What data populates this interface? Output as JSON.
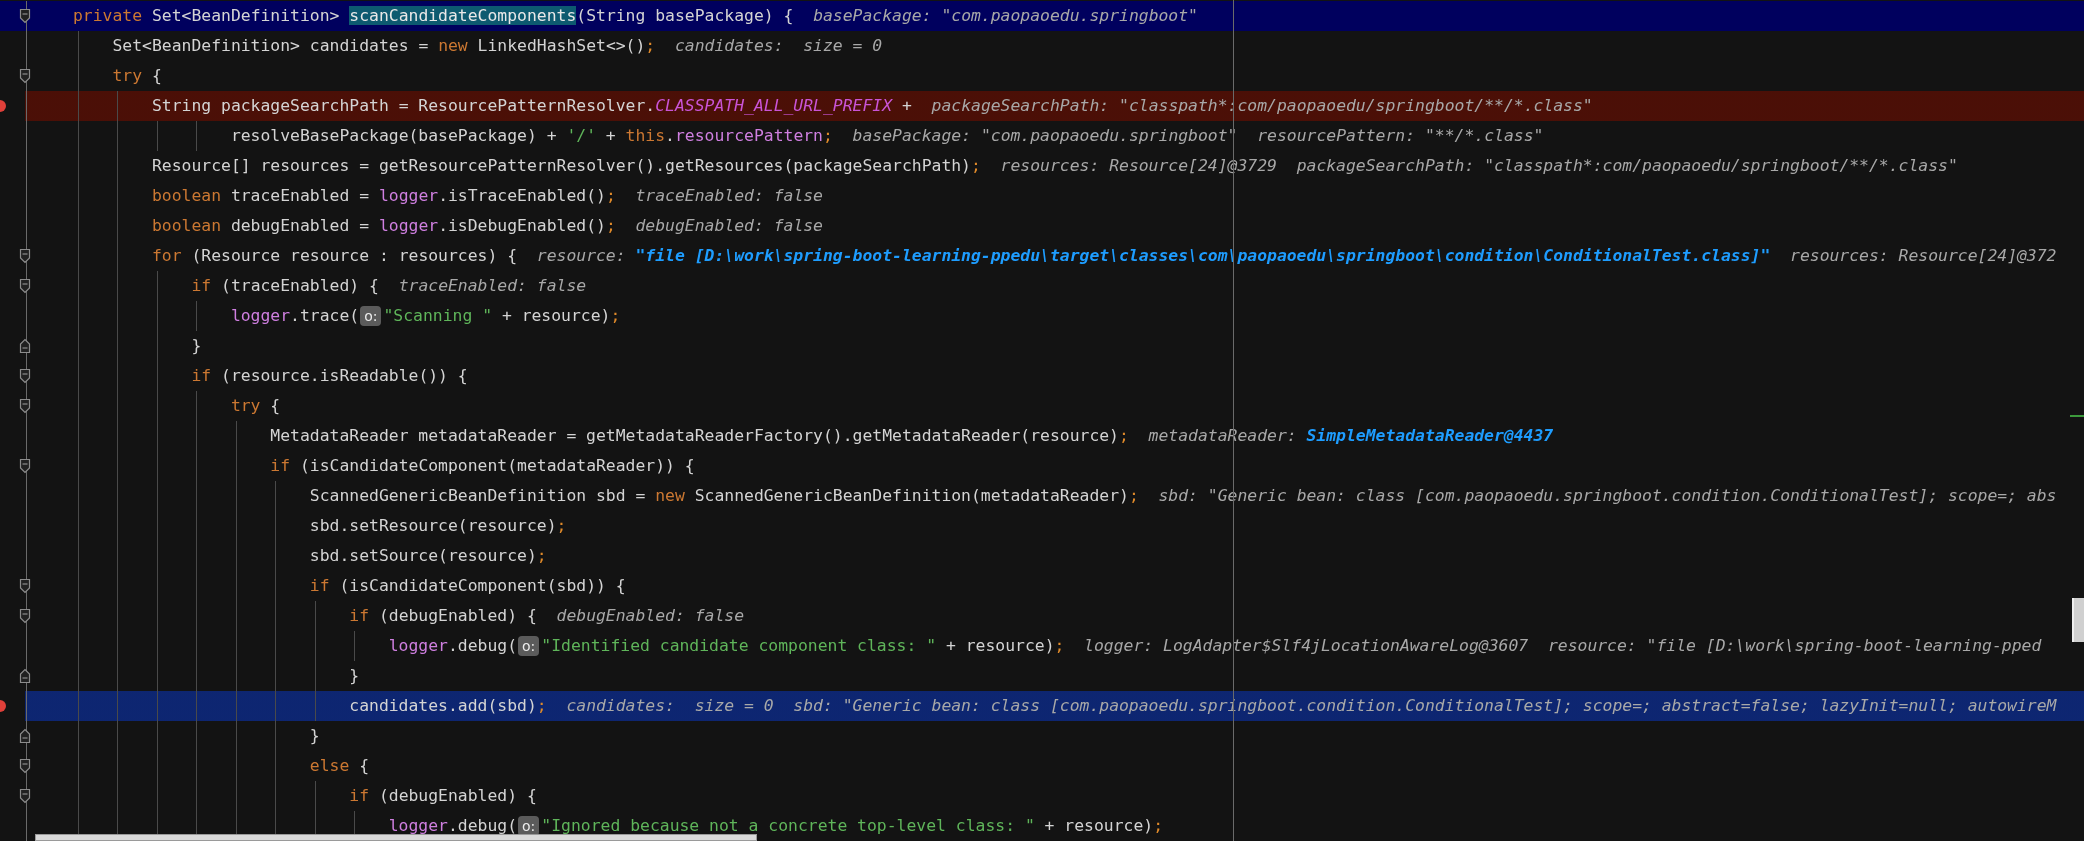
{
  "lines": [
    {
      "kind": "code",
      "expanded": true,
      "block_end": false,
      "selected": true,
      "breakpoint": false,
      "current": false,
      "tokens": [
        {
          "kind": "keyword",
          "text": "private"
        },
        {
          "kind": "plain",
          "text": " Set<BeanDefinition> "
        },
        {
          "kind": "match",
          "text": "scanCandidateComponents"
        },
        {
          "kind": "plain",
          "text": "(String basePackage) {"
        }
      ],
      "values": [
        {
          "kind": "plain",
          "text": "basePackage: \"com.paopaoedu.springboot\""
        }
      ],
      "children": [
        {
          "kind": "code",
          "expanded": false,
          "block_end": false,
          "selected": false,
          "breakpoint": false,
          "current": false,
          "tokens": [
            {
              "kind": "plain",
              "text": "Set<BeanDefinition> candidates = "
            },
            {
              "kind": "keyword",
              "text": "new"
            },
            {
              "kind": "plain",
              "text": " LinkedHashSet<>()"
            },
            {
              "kind": "punct",
              "text": ";"
            }
          ],
          "values": [
            {
              "kind": "plain",
              "text": "candidates:  size = 0"
            }
          ]
        },
        {
          "kind": "code",
          "expanded": true,
          "block_end": false,
          "selected": false,
          "breakpoint": false,
          "current": false,
          "tokens": [
            {
              "kind": "keyword",
              "text": "try"
            },
            {
              "kind": "plain",
              "text": " {"
            }
          ],
          "children": [
            {
              "kind": "code",
              "expanded": false,
              "block_end": false,
              "selected": false,
              "breakpoint": true,
              "current": false,
              "tokens": [
                {
                  "kind": "plain",
                  "text": "String packageSearchPath = ResourcePatternResolver."
                },
                {
                  "kind": "constant",
                  "text": "CLASSPATH_ALL_URL_PREFIX"
                },
                {
                  "kind": "plain",
                  "text": " +"
                }
              ],
              "values": [
                {
                  "kind": "plain",
                  "text": "packageSearchPath: \"classpath*:com/paopaoedu/springboot/**/*.class\""
                }
              ],
              "children": [
                {
                  "kind": "continuation",
                  "expanded": false,
                  "block_end": false,
                  "selected": false,
                  "breakpoint": false,
                  "current": false,
                  "tokens": [
                    {
                      "kind": "plain",
                      "text": "resolveBasePackage(basePackage) + "
                    },
                    {
                      "kind": "string",
                      "text": "'/'"
                    },
                    {
                      "kind": "plain",
                      "text": " + "
                    },
                    {
                      "kind": "keyword",
                      "text": "this"
                    },
                    {
                      "kind": "plain",
                      "text": "."
                    },
                    {
                      "kind": "member",
                      "text": "resourcePattern"
                    },
                    {
                      "kind": "punct",
                      "text": ";"
                    }
                  ],
                  "values": [
                    {
                      "kind": "plain",
                      "text": "basePackage: \"com.paopaoedu.springboot\""
                    },
                    {
                      "kind": "plain",
                      "text": "resourcePattern: \"**/*.class\""
                    }
                  ]
                }
              ]
            },
            {
              "kind": "code",
              "expanded": false,
              "block_end": false,
              "selected": false,
              "breakpoint": false,
              "current": false,
              "tokens": [
                {
                  "kind": "plain",
                  "text": "Resource[] resources = getResourcePatternResolver().getResources(packageSearchPath)"
                },
                {
                  "kind": "punct",
                  "text": ";"
                }
              ],
              "values": [
                {
                  "kind": "plain",
                  "text": "resources: Resource[24]@3729"
                },
                {
                  "kind": "plain",
                  "text": "packageSearchPath: \"classpath*:com/paopaoedu/springboot/**/*.class\""
                }
              ]
            },
            {
              "kind": "code",
              "expanded": false,
              "block_end": false,
              "selected": false,
              "breakpoint": false,
              "current": false,
              "tokens": [
                {
                  "kind": "keyword",
                  "text": "boolean"
                },
                {
                  "kind": "plain",
                  "text": " traceEnabled = "
                },
                {
                  "kind": "member",
                  "text": "logger"
                },
                {
                  "kind": "plain",
                  "text": ".isTraceEnabled()"
                },
                {
                  "kind": "punct",
                  "text": ";"
                }
              ],
              "values": [
                {
                  "kind": "plain",
                  "text": "traceEnabled: false"
                }
              ]
            },
            {
              "kind": "code",
              "expanded": false,
              "block_end": false,
              "selected": false,
              "breakpoint": false,
              "current": false,
              "tokens": [
                {
                  "kind": "keyword",
                  "text": "boolean"
                },
                {
                  "kind": "plain",
                  "text": " debugEnabled = "
                },
                {
                  "kind": "member",
                  "text": "logger"
                },
                {
                  "kind": "plain",
                  "text": ".isDebugEnabled()"
                },
                {
                  "kind": "punct",
                  "text": ";"
                }
              ],
              "values": [
                {
                  "kind": "plain",
                  "text": "debugEnabled: false"
                }
              ]
            },
            {
              "kind": "code",
              "expanded": true,
              "block_end": false,
              "selected": false,
              "breakpoint": false,
              "current": false,
              "tokens": [
                {
                  "kind": "keyword",
                  "text": "for"
                },
                {
                  "kind": "plain",
                  "text": " (Resource resource : resources) {"
                }
              ],
              "values": [
                {
                  "kind": "object",
                  "label": "resource:",
                  "value": "\"file [D:\\work\\spring-boot-learning-ppedu\\target\\classes\\com\\paopaoedu\\springboot\\condition\\ConditionalTest.class]\""
                },
                {
                  "kind": "plain",
                  "text": "resources: Resource[24]@372"
                }
              ],
              "children": [
                {
                  "kind": "code",
                  "expanded": true,
                  "block_end": false,
                  "selected": false,
                  "breakpoint": false,
                  "current": false,
                  "tokens": [
                    {
                      "kind": "keyword",
                      "text": "if"
                    },
                    {
                      "kind": "plain",
                      "text": " (traceEnabled) {"
                    }
                  ],
                  "values": [
                    {
                      "kind": "plain",
                      "text": "traceEnabled: false"
                    }
                  ],
                  "children": [
                    {
                      "kind": "code",
                      "expanded": false,
                      "block_end": false,
                      "selected": false,
                      "breakpoint": false,
                      "current": false,
                      "tokens": [
                        {
                          "kind": "member",
                          "text": "logger"
                        },
                        {
                          "kind": "plain",
                          "text": ".trace("
                        },
                        {
                          "kind": "hint",
                          "text": "o:"
                        },
                        {
                          "kind": "string",
                          "text": "\"Scanning \""
                        },
                        {
                          "kind": "plain",
                          "text": " + resource)"
                        },
                        {
                          "kind": "punct",
                          "text": ";"
                        }
                      ]
                    }
                  ]
                },
                {
                  "kind": "code",
                  "expanded": false,
                  "block_end": true,
                  "selected": false,
                  "breakpoint": false,
                  "current": false,
                  "tokens": [
                    {
                      "kind": "plain",
                      "text": "}"
                    }
                  ]
                },
                {
                  "kind": "code",
                  "expanded": true,
                  "block_end": false,
                  "selected": false,
                  "breakpoint": false,
                  "current": false,
                  "tokens": [
                    {
                      "kind": "keyword",
                      "text": "if"
                    },
                    {
                      "kind": "plain",
                      "text": " (resource.isReadable()) {"
                    }
                  ],
                  "children": [
                    {
                      "kind": "code",
                      "expanded": true,
                      "block_end": false,
                      "selected": false,
                      "breakpoint": false,
                      "current": false,
                      "tokens": [
                        {
                          "kind": "keyword",
                          "text": "try"
                        },
                        {
                          "kind": "plain",
                          "text": " {"
                        }
                      ],
                      "children": [
                        {
                          "kind": "code",
                          "expanded": false,
                          "block_end": false,
                          "selected": false,
                          "breakpoint": false,
                          "current": false,
                          "tokens": [
                            {
                              "kind": "plain",
                              "text": "MetadataReader metadataReader = getMetadataReaderFactory().getMetadataReader(resource)"
                            },
                            {
                              "kind": "punct",
                              "text": ";"
                            }
                          ],
                          "values": [
                            {
                              "kind": "object",
                              "label": "metadataReader:",
                              "value": "SimpleMetadataReader@4437"
                            }
                          ]
                        },
                        {
                          "kind": "code",
                          "expanded": true,
                          "block_end": false,
                          "selected": false,
                          "breakpoint": false,
                          "current": false,
                          "tokens": [
                            {
                              "kind": "keyword",
                              "text": "if"
                            },
                            {
                              "kind": "plain",
                              "text": " (isCandidateComponent(metadataReader)) {"
                            }
                          ],
                          "children": [
                            {
                              "kind": "code",
                              "expanded": false,
                              "block_end": false,
                              "selected": false,
                              "breakpoint": false,
                              "current": false,
                              "tokens": [
                                {
                                  "kind": "plain",
                                  "text": "ScannedGenericBeanDefinition sbd = "
                                },
                                {
                                  "kind": "keyword",
                                  "text": "new"
                                },
                                {
                                  "kind": "plain",
                                  "text": " ScannedGenericBeanDefinition(metadataReader)"
                                },
                                {
                                  "kind": "punct",
                                  "text": ";"
                                }
                              ],
                              "values": [
                                {
                                  "kind": "plain",
                                  "text": "sbd: \"Generic bean: class [com.paopaoedu.springboot.condition.ConditionalTest]; scope=; abs"
                                }
                              ]
                            },
                            {
                              "kind": "code",
                              "expanded": false,
                              "block_end": false,
                              "selected": false,
                              "breakpoint": false,
                              "current": false,
                              "tokens": [
                                {
                                  "kind": "plain",
                                  "text": "sbd.setResource(resource)"
                                },
                                {
                                  "kind": "punct",
                                  "text": ";"
                                }
                              ]
                            },
                            {
                              "kind": "code",
                              "expanded": false,
                              "block_end": false,
                              "selected": false,
                              "breakpoint": false,
                              "current": false,
                              "tokens": [
                                {
                                  "kind": "plain",
                                  "text": "sbd.setSource(resource)"
                                },
                                {
                                  "kind": "punct",
                                  "text": ";"
                                }
                              ]
                            },
                            {
                              "kind": "code",
                              "expanded": true,
                              "block_end": false,
                              "selected": false,
                              "breakpoint": false,
                              "current": false,
                              "tokens": [
                                {
                                  "kind": "keyword",
                                  "text": "if"
                                },
                                {
                                  "kind": "plain",
                                  "text": " (isCandidateComponent(sbd)) {"
                                }
                              ],
                              "children": [
                                {
                                  "kind": "code",
                                  "expanded": true,
                                  "block_end": false,
                                  "selected": false,
                                  "breakpoint": false,
                                  "current": false,
                                  "tokens": [
                                    {
                                      "kind": "keyword",
                                      "text": "if"
                                    },
                                    {
                                      "kind": "plain",
                                      "text": " (debugEnabled) {"
                                    }
                                  ],
                                  "values": [
                                    {
                                      "kind": "plain",
                                      "text": "debugEnabled: false"
                                    }
                                  ],
                                  "children": [
                                    {
                                      "kind": "code",
                                      "expanded": false,
                                      "block_end": false,
                                      "selected": false,
                                      "breakpoint": false,
                                      "current": false,
                                      "tokens": [
                                        {
                                          "kind": "member",
                                          "text": "logger"
                                        },
                                        {
                                          "kind": "plain",
                                          "text": ".debug("
                                        },
                                        {
                                          "kind": "hint",
                                          "text": "o:"
                                        },
                                        {
                                          "kind": "string",
                                          "text": "\"Identified candidate component class: \""
                                        },
                                        {
                                          "kind": "plain",
                                          "text": " + resource)"
                                        },
                                        {
                                          "kind": "punct",
                                          "text": ";"
                                        }
                                      ],
                                      "values": [
                                        {
                                          "kind": "plain",
                                          "text": "logger: LogAdapter$Slf4jLocationAwareLog@3607"
                                        },
                                        {
                                          "kind": "plain",
                                          "text": "resource: \"file [D:\\work\\spring-boot-learning-pped"
                                        }
                                      ]
                                    }
                                  ]
                                },
                                {
                                  "kind": "code",
                                  "expanded": false,
                                  "block_end": true,
                                  "selected": false,
                                  "breakpoint": false,
                                  "current": false,
                                  "tokens": [
                                    {
                                      "kind": "plain",
                                      "text": "}"
                                    }
                                  ]
                                },
                                {
                                  "kind": "code",
                                  "expanded": false,
                                  "block_end": false,
                                  "selected": false,
                                  "breakpoint": true,
                                  "current": true,
                                  "tokens": [
                                    {
                                      "kind": "plain",
                                      "text": "candidates.add(sbd)"
                                    },
                                    {
                                      "kind": "punct",
                                      "text": ";"
                                    }
                                  ],
                                  "values": [
                                    {
                                      "kind": "plain",
                                      "text": "candidates:  size = 0"
                                    },
                                    {
                                      "kind": "plain",
                                      "text": "sbd: \"Generic bean: class [com.paopaoedu.springboot.condition.ConditionalTest]; scope=; abstract=false; lazyInit=null; autowireM"
                                    }
                                  ]
                                }
                              ]
                            },
                            {
                              "kind": "code",
                              "expanded": false,
                              "block_end": true,
                              "selected": false,
                              "breakpoint": false,
                              "current": false,
                              "tokens": [
                                {
                                  "kind": "plain",
                                  "text": "}"
                                }
                              ]
                            },
                            {
                              "kind": "code",
                              "expanded": true,
                              "block_end": false,
                              "selected": false,
                              "breakpoint": false,
                              "current": false,
                              "tokens": [
                                {
                                  "kind": "keyword",
                                  "text": "else"
                                },
                                {
                                  "kind": "plain",
                                  "text": " {"
                                }
                              ],
                              "children": [
                                {
                                  "kind": "code",
                                  "expanded": true,
                                  "block_end": false,
                                  "selected": false,
                                  "breakpoint": false,
                                  "current": false,
                                  "tokens": [
                                    {
                                      "kind": "keyword",
                                      "text": "if"
                                    },
                                    {
                                      "kind": "plain",
                                      "text": " (debugEnabled) {"
                                    }
                                  ],
                                  "children": [
                                    {
                                      "kind": "code",
                                      "expanded": false,
                                      "block_end": false,
                                      "selected": false,
                                      "breakpoint": false,
                                      "current": false,
                                      "tokens": [
                                        {
                                          "kind": "member",
                                          "text": "logger"
                                        },
                                        {
                                          "kind": "plain",
                                          "text": ".debug("
                                        },
                                        {
                                          "kind": "hint",
                                          "text": "o:"
                                        },
                                        {
                                          "kind": "string",
                                          "text": "\"Ignored because not a concrete top-level class: \""
                                        },
                                        {
                                          "kind": "plain",
                                          "text": " + resource)"
                                        },
                                        {
                                          "kind": "punct",
                                          "text": ";"
                                        }
                                      ]
                                    }
                                  ]
                                }
                              ]
                            }
                          ]
                        }
                      ]
                    }
                  ]
                }
              ]
            }
          ]
        }
      ]
    }
  ]
}
